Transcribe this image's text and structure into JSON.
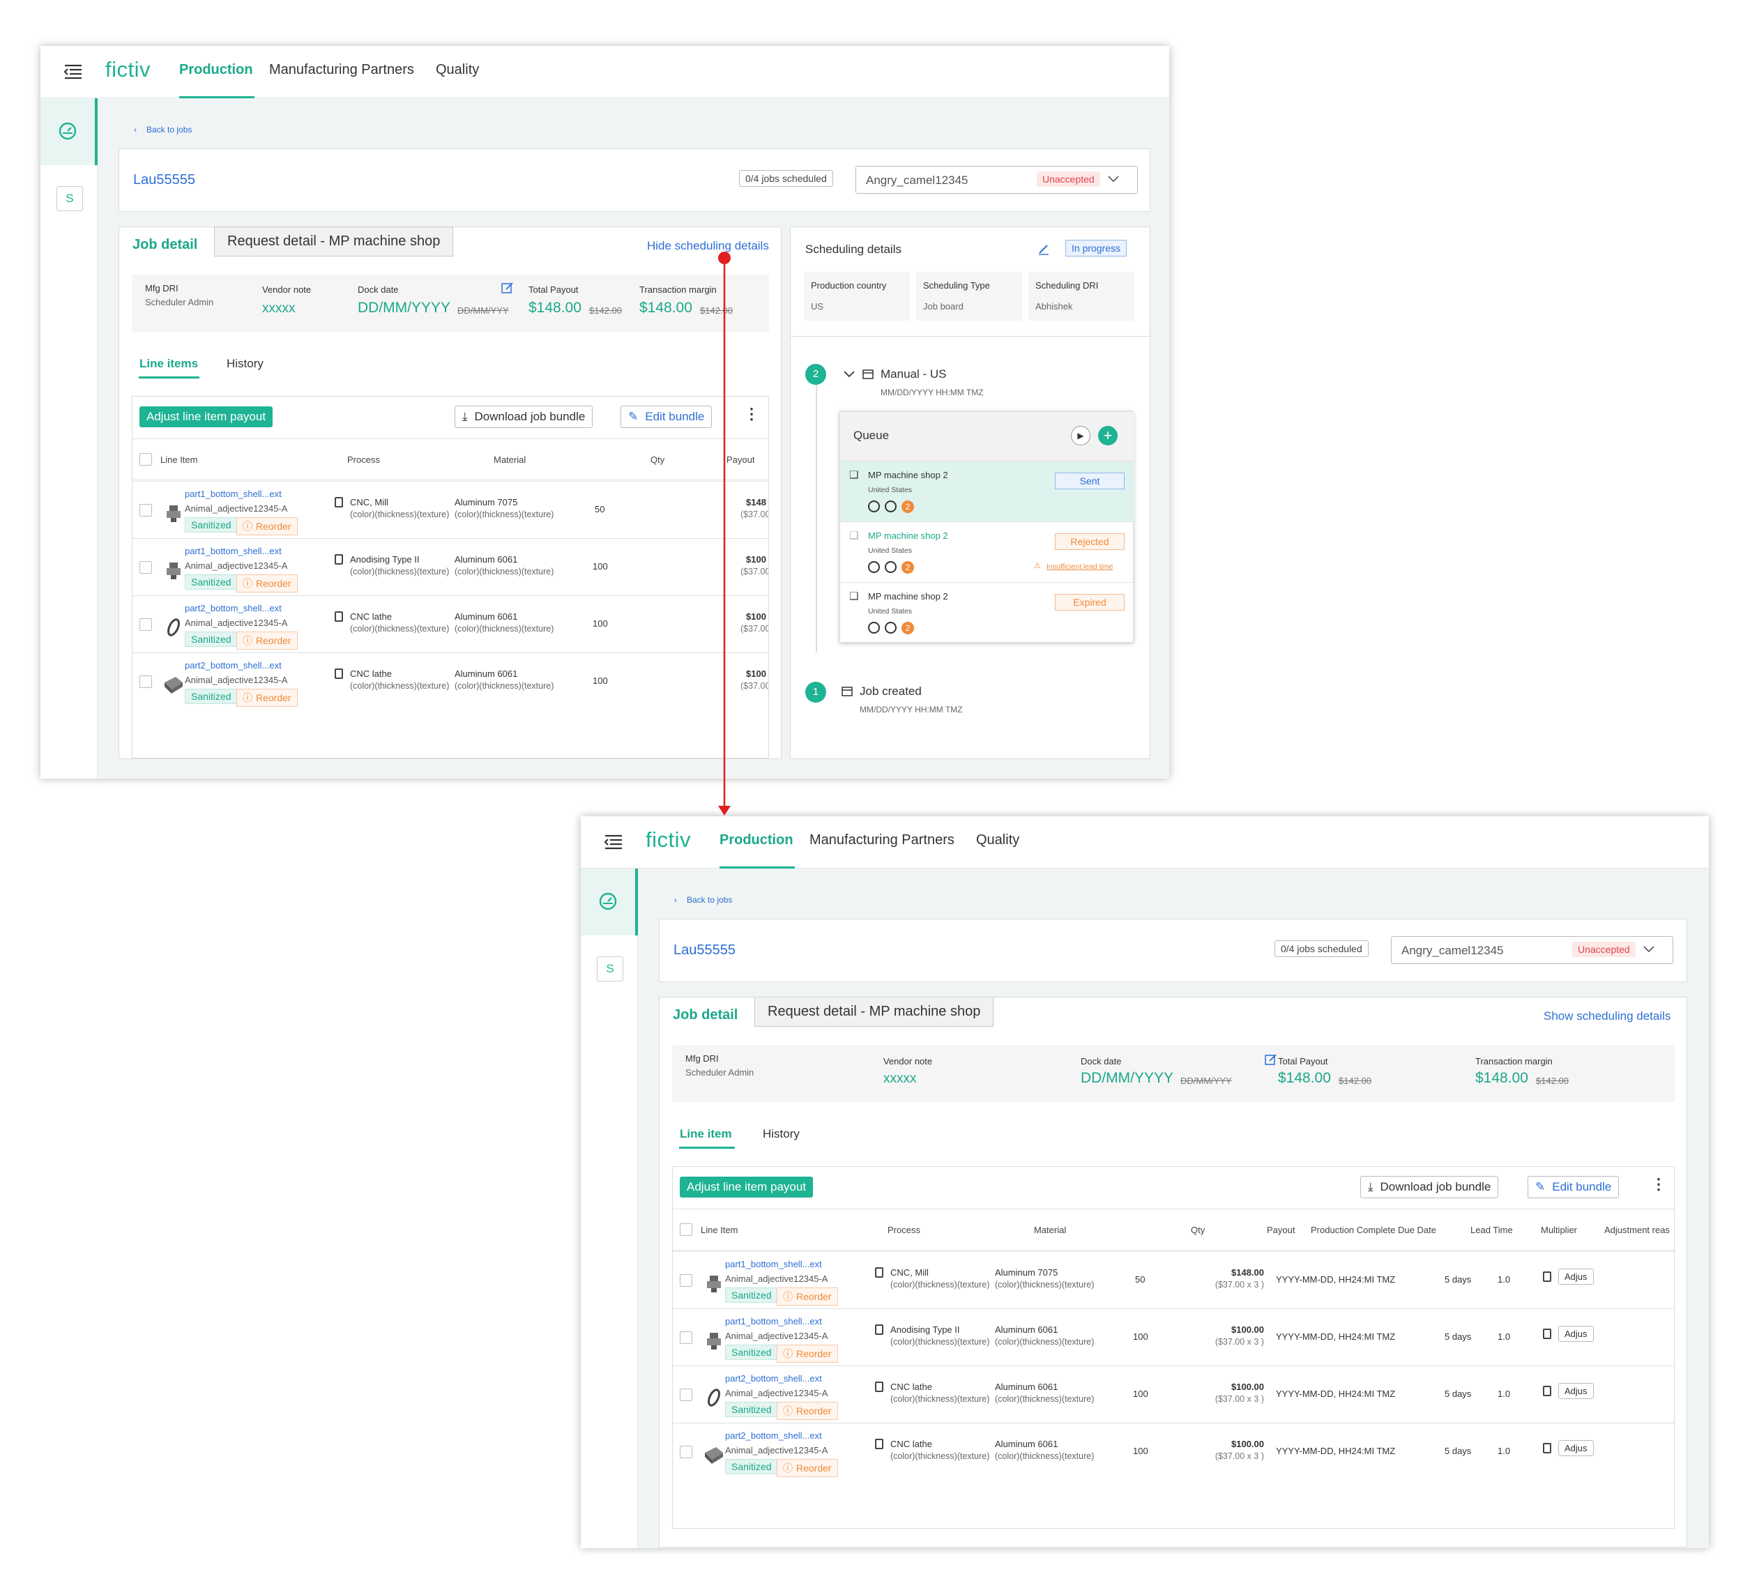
{
  "nav": {
    "logo": "fictiv",
    "production": "Production",
    "partners": "Manufacturing Partners",
    "quality": "Quality"
  },
  "rail": {
    "s_label": "S"
  },
  "back": "Back to jobs",
  "job": {
    "id": "Lau55555",
    "scheduled": "0/4 jobs scheduled",
    "vendor": "Angry_camel12345",
    "status": "Unaccepted"
  },
  "tabs": {
    "job_detail": "Job detail",
    "request_detail": "Request detail - MP machine shop",
    "hide_sched": "Hide scheduling details",
    "show_sched": "Show scheduling details"
  },
  "info": {
    "mfg_label": "Mfg DRI",
    "mfg_value": "Scheduler Admin",
    "vendor_note_label": "Vendor note",
    "vendor_note_value": "xxxxx",
    "dock_label": "Dock date",
    "dock_value": "DD/MM/YYYY",
    "dock_old": "DD/MM/YYY",
    "payout_label": "Total Payout",
    "payout_value": "$148.00",
    "payout_old": "$142.00",
    "margin_label": "Transaction margin",
    "margin_value": "$148.00",
    "margin_old": "$142.00"
  },
  "subtabs": {
    "line_items": "Line items",
    "line_item": "Line item",
    "history": "History"
  },
  "toolbar": {
    "adjust": "Adjust line item payout",
    "download": "Download job bundle",
    "edit": "Edit bundle"
  },
  "columns": {
    "line_item": "Line Item",
    "process": "Process",
    "material": "Material",
    "qty": "Qty",
    "payout": "Payout",
    "due": "Production Complete Due Date",
    "lead": "Lead Time",
    "mult": "Multiplier",
    "adj": "Adjustment reas"
  },
  "rows": [
    {
      "file": "part1_bottom_shell...ext",
      "name": "Animal_adjective12345-A",
      "tag1": "Sanitized",
      "tag2": "Reorder",
      "process": "CNC, Mill",
      "pattr": "(color)(thickness)(texture)",
      "material": "Aluminum 7075",
      "mattr": "(color)(thickness)(texture)",
      "qty": "50",
      "payout": "$148.00",
      "paysub": "($37.00 x 3 )",
      "pay_cut": "$148",
      "paysub_cut": "($37.00",
      "due": "YYYY-MM-DD, HH24:MI TMZ",
      "lead": "5 days",
      "mult": "1.0",
      "adj": "Adjus"
    },
    {
      "file": "part1_bottom_shell...ext",
      "name": "Animal_adjective12345-A",
      "tag1": "Sanitized",
      "tag2": "Reorder",
      "process": "Anodising Type II",
      "pattr": "(color)(thickness)(texture)",
      "material": "Aluminum 6061",
      "mattr": "(color)(thickness)(texture)",
      "qty": "100",
      "payout": "$100.00",
      "paysub": "($37.00 x 3 )",
      "pay_cut": "$100",
      "paysub_cut": "($37.00",
      "due": "YYYY-MM-DD, HH24:MI TMZ",
      "lead": "5 days",
      "mult": "1.0",
      "adj": "Adjus"
    },
    {
      "file": "part2_bottom_shell...ext",
      "name": "Animal_adjective12345-A",
      "tag1": "Sanitized",
      "tag2": "Reorder",
      "process": "CNC lathe",
      "pattr": "(color)(thickness)(texture)",
      "material": "Aluminum 6061",
      "mattr": "(color)(thickness)(texture)",
      "qty": "100",
      "payout": "$100.00",
      "paysub": "($37.00 x 3 )",
      "pay_cut": "$100",
      "paysub_cut": "($37.00",
      "due": "YYYY-MM-DD, HH24:MI TMZ",
      "lead": "5 days",
      "mult": "1.0",
      "adj": "Adjus"
    },
    {
      "file": "part2_bottom_shell...ext",
      "name": "Animal_adjective12345-A",
      "tag1": "Sanitized",
      "tag2": "Reorder",
      "process": "CNC lathe",
      "pattr": "(color)(thickness)(texture)",
      "material": "Aluminum 6061",
      "mattr": "(color)(thickness)(texture)",
      "qty": "100",
      "payout": "$100.00",
      "paysub": "($37.00 x 3 )",
      "pay_cut": "$100",
      "paysub_cut": "($37.00",
      "due": "YYYY-MM-DD, HH24:MI TMZ",
      "lead": "5 days",
      "mult": "1.0",
      "adj": "Adjus"
    }
  ],
  "sched": {
    "title": "Scheduling details",
    "status": "In progress",
    "country_label": "Production country",
    "country_value": "US",
    "type_label": "Scheduling Type",
    "type_value": "Job board",
    "dri_label": "Scheduling DRI",
    "dri_value": "Abhishek",
    "step2": "2",
    "step2_title": "Manual - US",
    "step2_time": "MM/DD/YYYY HH:MM TMZ",
    "queue": "Queue",
    "queue_items": [
      {
        "shop": "MP machine shop 2",
        "country": "United States",
        "status": "Sent",
        "count": "2"
      },
      {
        "shop": "MP machine shop 2",
        "country": "United States",
        "status": "Rejected",
        "count": "2",
        "warn": "Insufficient lead time"
      },
      {
        "shop": "MP machine shop 2",
        "country": "United States",
        "status": "Expired",
        "count": "2"
      }
    ],
    "step1": "1",
    "step1_title": "Job created",
    "step1_time": "MM/DD/YYYY HH:MM TMZ"
  },
  "colors": {
    "teal": "#1db393",
    "blue": "#2d6fd3",
    "red": "#e0454a",
    "orange": "#f08a38",
    "arrow": "#e02020"
  }
}
